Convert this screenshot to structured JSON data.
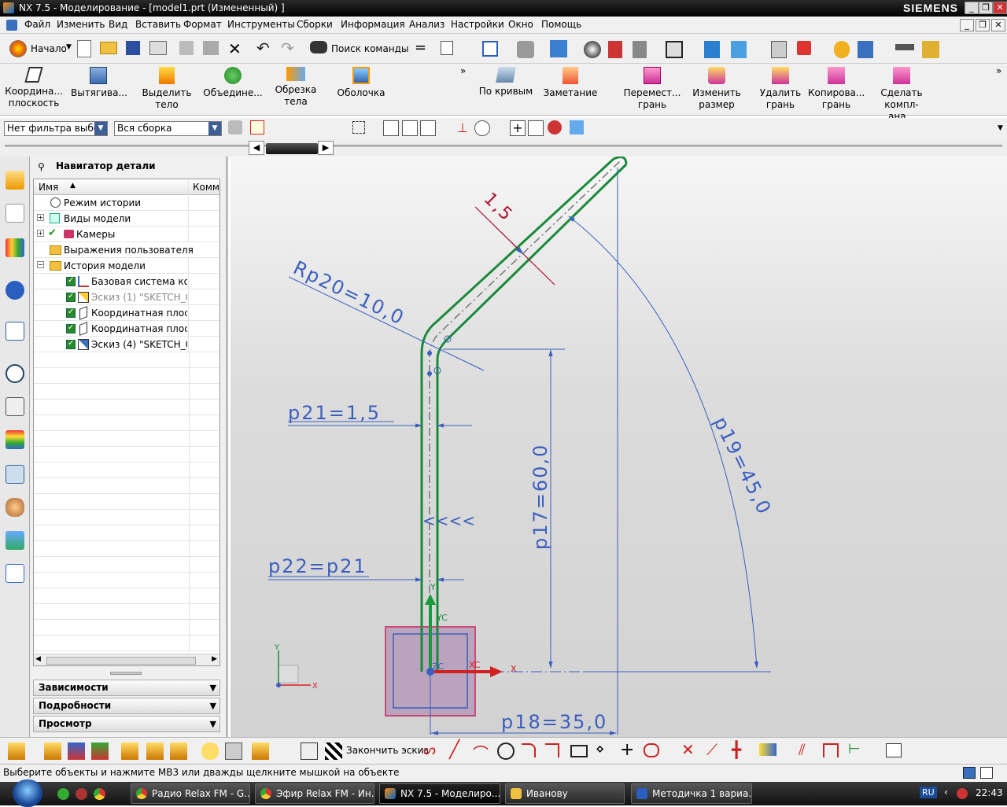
{
  "window": {
    "title": "NX 7.5 - Моделирование - [model1.prt (Измененный) ]",
    "brand": "SIEMENS"
  },
  "menu": [
    "Файл",
    "Изменить",
    "Вид",
    "Вставить",
    "Формат",
    "Инструменты",
    "Сборки",
    "Информация",
    "Анализ",
    "Настройки",
    "Окно",
    "Помощь"
  ],
  "toolbar1": {
    "start_label": "Начало",
    "find_command_label": "Поиск команды"
  },
  "toolbar2": {
    "datum_plane": "Координа... плоскость",
    "extrude": "Вытягива...",
    "extract_body": "Выделить тело",
    "unite": "Объедине...",
    "trim_body": "Обрезка тела",
    "shell": "Оболочка",
    "through_curves": "По кривым",
    "sweep": "Заметание",
    "move_face": "Перемест... грань",
    "resize": "Изменить размер",
    "delete_face": "Удалить грань",
    "copy_face": "Копирова... грань",
    "make_coplanar": "Сделать компл­ана..."
  },
  "filters": {
    "selection_filter": "Нет фильтра выбор",
    "assembly_scope": "Вся сборка"
  },
  "navigator": {
    "title": "Навигатор детали",
    "col_name": "Имя",
    "col_comment": "Комм",
    "rows": [
      {
        "label": "Режим истории"
      },
      {
        "label": "Виды модели"
      },
      {
        "label": "Камеры"
      },
      {
        "label": "Выражения пользователя"
      },
      {
        "label": "История модели"
      },
      {
        "label": "Базовая система ко..."
      },
      {
        "label": "Эскиз (1) \"SKETCH_0..."
      },
      {
        "label": "Координатная плос..."
      },
      {
        "label": "Координатная плос..."
      },
      {
        "label": "Эскиз (4) \"SKETCH_0..."
      }
    ],
    "panels": [
      "Зависимости",
      "Подробности",
      "Просмотр"
    ]
  },
  "sketch": {
    "dim_p21": "p21=1,5",
    "dim_p22": "p22=p21",
    "dim_p17": "p17=60,0",
    "dim_p18": "p18=35,0",
    "dim_p19": "p19=45,0",
    "dim_rp20": "Rp20=10,0",
    "dim_thickness": "1,5",
    "axis_x": "X",
    "axis_y": "Y",
    "axis_xc": "XC",
    "axis_yc": "YC",
    "axis_zc": "ZC"
  },
  "toolbar4": {
    "finish_sketch": "Закончить эскиз"
  },
  "status": {
    "message": "Выберите объекты и нажмите МВ3 или дважды щелкните мышкой на объекте"
  },
  "taskbar": {
    "items": [
      "Радио Relax FM - G...",
      "Эфир Relax FM - Ин...",
      "NX 7.5 - Моделиро...",
      "Иванову",
      "Методичка 1 вариа..."
    ],
    "lang": "RU",
    "clock": "22:43"
  },
  "colors": {
    "dimension": "#3b5fc0",
    "geometry": "#1a8a3a",
    "accent_red": "#b01030"
  }
}
